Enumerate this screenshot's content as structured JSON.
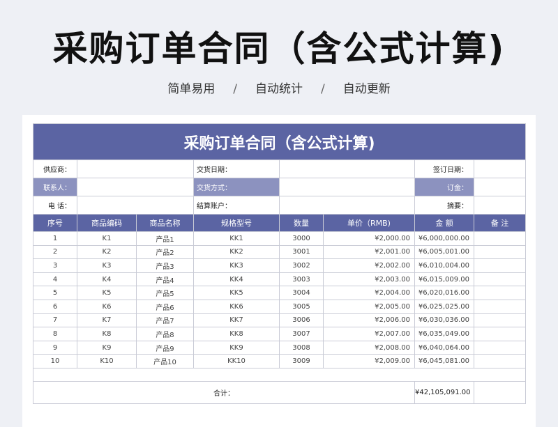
{
  "page": {
    "title": "采购订单合同（含公式计算)",
    "tagline": [
      "简单易用",
      "自动统计",
      "自动更新"
    ],
    "tagline_separator": "/"
  },
  "contract": {
    "title": "采购订单合同（含公式计算)",
    "info": {
      "supplier_label": "供应商：",
      "delivery_date_label": "交货日期：",
      "sign_date_label": "签订日期：",
      "contact_label": "联系人：",
      "delivery_method_label": "交货方式：",
      "deposit_label": "订金：",
      "phone_label": "电  话：",
      "settlement_account_label": "结算账户：",
      "summary_label": "摘要："
    },
    "columns": [
      "序号",
      "商品编码",
      "商品名称",
      "规格型号",
      "数量",
      "单价（RMB)",
      "金  额",
      "备  注"
    ],
    "rows": [
      [
        "1",
        "K1",
        "产品1",
        "KK1",
        "3000",
        "¥2,000.00",
        "¥6,000,000.00",
        ""
      ],
      [
        "2",
        "K2",
        "产品2",
        "KK2",
        "3001",
        "¥2,001.00",
        "¥6,005,001.00",
        ""
      ],
      [
        "3",
        "K3",
        "产品3",
        "KK3",
        "3002",
        "¥2,002.00",
        "¥6,010,004.00",
        ""
      ],
      [
        "4",
        "K4",
        "产品4",
        "KK4",
        "3003",
        "¥2,003.00",
        "¥6,015,009.00",
        ""
      ],
      [
        "5",
        "K5",
        "产品5",
        "KK5",
        "3004",
        "¥2,004.00",
        "¥6,020,016.00",
        ""
      ],
      [
        "6",
        "K6",
        "产品6",
        "KK6",
        "3005",
        "¥2,005.00",
        "¥6,025,025.00",
        ""
      ],
      [
        "7",
        "K7",
        "产品7",
        "KK7",
        "3006",
        "¥2,006.00",
        "¥6,030,036.00",
        ""
      ],
      [
        "8",
        "K8",
        "产品8",
        "KK8",
        "3007",
        "¥2,007.00",
        "¥6,035,049.00",
        ""
      ],
      [
        "9",
        "K9",
        "产品9",
        "KK9",
        "3008",
        "¥2,008.00",
        "¥6,040,064.00",
        ""
      ],
      [
        "10",
        "K10",
        "产品10",
        "KK10",
        "3009",
        "¥2,009.00",
        "¥6,045,081.00",
        ""
      ]
    ],
    "total_label": "合计：",
    "total_amount": "¥42,105,091.00"
  },
  "colors": {
    "header_bg": "#5b64a3",
    "label_alt_bg": "#8c92bf",
    "page_bg": "#eef0f5",
    "grid": "#c9cbd6"
  }
}
